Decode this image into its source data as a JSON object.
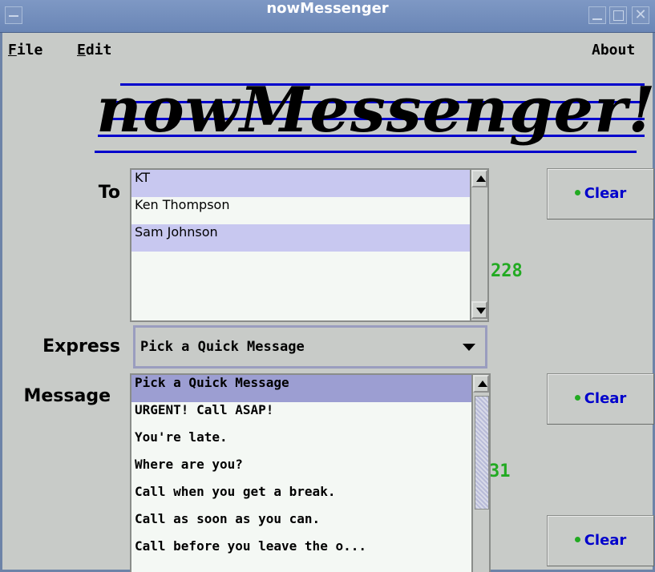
{
  "window": {
    "title": "nowMessenger"
  },
  "menu": {
    "file": "File",
    "edit": "Edit",
    "about": "About"
  },
  "logo": {
    "text": "nowMessenger!"
  },
  "to": {
    "label": "To",
    "recipients": [
      {
        "name": "KT",
        "selected": true
      },
      {
        "name": "Ken Thompson",
        "selected": false
      },
      {
        "name": "Sam Johnson",
        "selected": true
      }
    ],
    "clear_label": "Clear",
    "count": "228"
  },
  "express": {
    "label": "Express",
    "selected": "Pick a Quick Message"
  },
  "message": {
    "label": "Message",
    "options": [
      "Pick a Quick Message",
      "URGENT! Call ASAP!",
      "You're late.",
      "Where are you?",
      "Call when you get a break.",
      "Call as soon as you can.",
      "Call before you leave the o..."
    ],
    "clear_label": "Clear",
    "count_partial": "31"
  },
  "third_clear_label": "Clear",
  "colors": {
    "accent": "#0000cc",
    "count": "#22aa22",
    "titlebar": "#6a86b6"
  }
}
